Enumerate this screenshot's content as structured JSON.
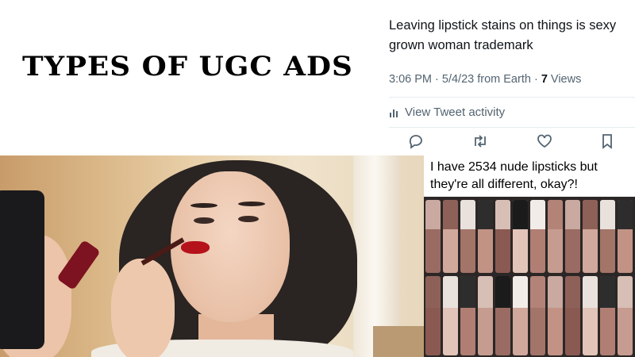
{
  "title": "TYPES OF UGC ADS",
  "tweet": {
    "text": "Leaving lipstick stains on things is sexy grown woman trademark",
    "meta_prefix": "3:06 PM · 5/4/23 from Earth · ",
    "views_count": "7",
    "views_label": " Views",
    "activity_label": "View Tweet activity",
    "actions": [
      "reply-icon",
      "retweet-icon",
      "like-icon",
      "bookmark-icon"
    ]
  },
  "meme": {
    "caption": "I have 2534 nude lipsticks but they're all different, okay?!"
  },
  "colors": {
    "text_dark": "#0f1419",
    "text_muted": "#536471",
    "lip_red": "#b5121b"
  }
}
